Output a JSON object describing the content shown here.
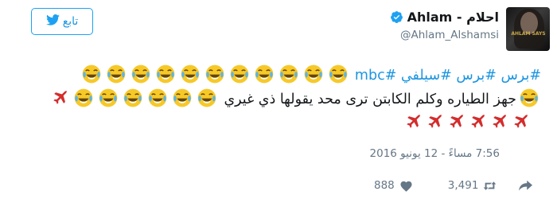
{
  "tweet": {
    "display_name": "Ahlam - احلام",
    "handle": "@Ahlam_Alshamsi",
    "verified": true,
    "avatar_caption": "AHLAM SAYS",
    "follow_label": "تابع",
    "text_line1": "#برس #برس #سيلفي #mbc",
    "text_line2": "جهز الطياره وكلم الكابتن ترى محد يقولها ذي غيري",
    "emoji_name": "face-with-tears-of-joy",
    "plane_name": "airplane",
    "timestamp": "7:56 مساءً - 12 يونيو 2016",
    "retweets": "3,491",
    "likes": "888",
    "colors": {
      "link": "#1b95e0",
      "muted": "#657786",
      "emoji": "#f7c928",
      "tears": "#5bb3e8",
      "plane": "#d42d2d"
    }
  }
}
